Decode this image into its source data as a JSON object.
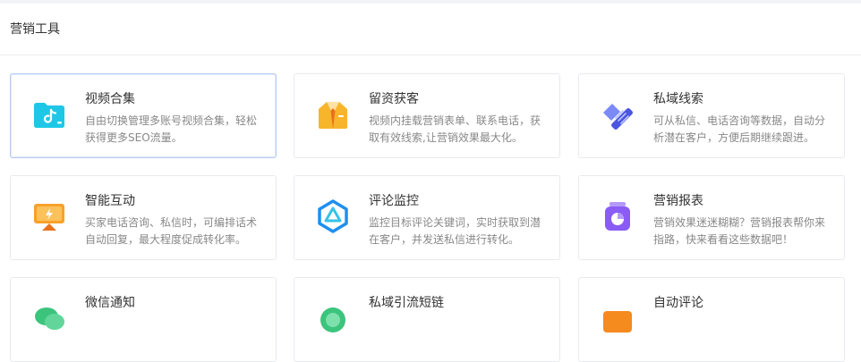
{
  "section": {
    "title": "营销工具"
  },
  "tools": [
    {
      "title": "视频合集",
      "desc": "自由切换管理多账号视频合集，轻松获得更多SEO流量。",
      "icon": "video-folder-icon",
      "color": "#1fc7e6"
    },
    {
      "title": "留资获客",
      "desc": "视频内挂载营销表单、联系电话，获取有效线索,让营销效果最大化。",
      "icon": "suit-icon",
      "color": "#f7b52c"
    },
    {
      "title": "私域线索",
      "desc": "可从私信、电话咨询等数据，自动分析潜在客户，方便后期继续跟进。",
      "icon": "handshake-icon",
      "color": "#5b6cf0"
    },
    {
      "title": "智能互动",
      "desc": "买家电话咨询、私信时，可编排话术自动回复，最大程度促成转化率。",
      "icon": "interaction-screen-icon",
      "color": "#f7a12a"
    },
    {
      "title": "评论监控",
      "desc": "监控目标评论关键词，实时获取到潜在客户，并发送私信进行转化。",
      "icon": "monitor-eye-icon",
      "color": "#1e8ff0"
    },
    {
      "title": "营销报表",
      "desc": "营销效果迷迷糊糊？营销报表帮你来指路，快来看看这些数据吧！",
      "icon": "report-jar-icon",
      "color": "#8a5cf5"
    },
    {
      "title": "微信通知",
      "desc": "",
      "icon": "wechat-icon",
      "color": "#3cc47c"
    },
    {
      "title": "私域引流短链",
      "desc": "",
      "icon": "link-icon",
      "color": "#3cc47c"
    },
    {
      "title": "自动评论",
      "desc": "",
      "icon": "comment-icon",
      "color": "#f58a1f"
    }
  ]
}
